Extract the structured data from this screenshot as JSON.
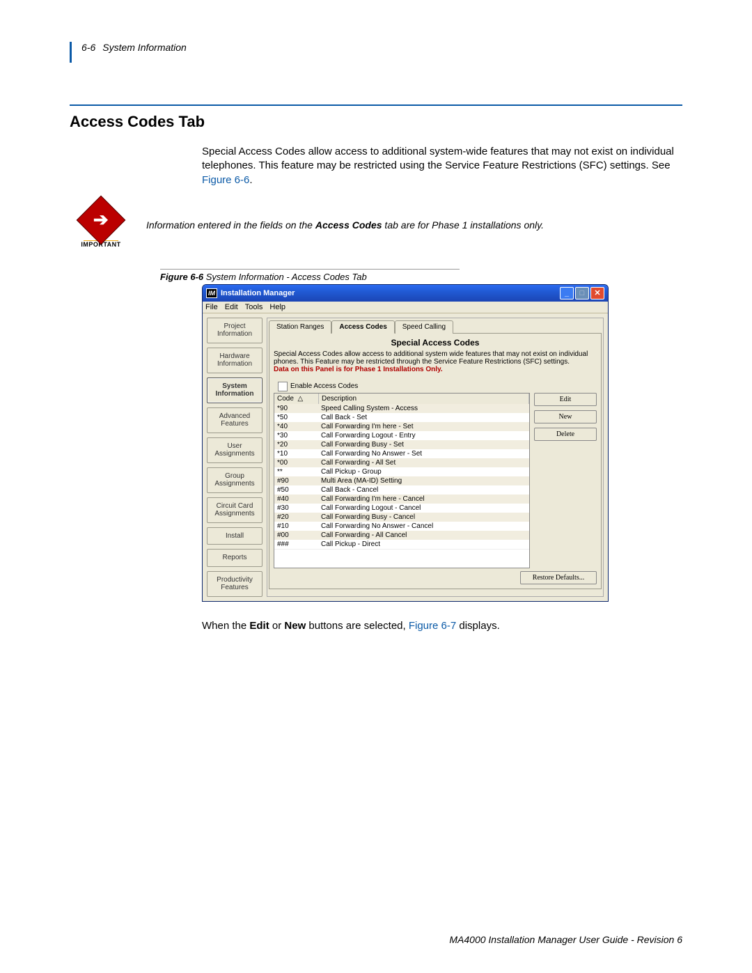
{
  "header": {
    "page_num": "6-6",
    "section": "System Information"
  },
  "title": "Access Codes Tab",
  "intro": {
    "text": "Special Access Codes allow access to additional system-wide features that may not exist on individual telephones. This feature may be restricted using the Service Feature Restrictions (SFC) settings. See ",
    "figref": "Figure 6-6",
    "period": "."
  },
  "important": {
    "label": "IMPORTANT",
    "note_pre": "Information entered in the fields on the ",
    "note_bold": "Access Codes",
    "note_post": " tab are for Phase 1 installations only."
  },
  "fig_caption_bold": "Figure 6-6",
  "fig_caption_rest": "  System Information - Access Codes Tab",
  "win": {
    "title": "Installation Manager",
    "menu": [
      "File",
      "Edit",
      "Tools",
      "Help"
    ],
    "nav": [
      "Project Information",
      "Hardware Information",
      "System Information",
      "Advanced Features",
      "User Assignments",
      "Group Assignments",
      "Circuit Card Assignments",
      "Install",
      "Reports",
      "Productivity Features"
    ],
    "active_nav_index": 2,
    "tabs": [
      "Station Ranges",
      "Access Codes",
      "Speed Calling"
    ],
    "active_tab_index": 1,
    "pane_title": "Special Access Codes",
    "pane_desc": "Special Access Codes allow access to additional system wide features that may not exist on individual phones.  This Feature may be restricted through the Service Feature Restrictions (SFC) settings.",
    "pane_red": "Data on this Panel is for Phase 1 Installations Only.",
    "enable_label": "Enable Access Codes",
    "cols": {
      "c1": "Code",
      "c2": "Description"
    },
    "rows": [
      {
        "code": "*90",
        "desc": "Speed Calling System - Access"
      },
      {
        "code": "*50",
        "desc": "Call Back - Set"
      },
      {
        "code": "*40",
        "desc": "Call Forwarding I'm here - Set"
      },
      {
        "code": "*30",
        "desc": "Call Forwarding Logout - Entry"
      },
      {
        "code": "*20",
        "desc": "Call Forwarding Busy - Set"
      },
      {
        "code": "*10",
        "desc": "Call Forwarding No Answer - Set"
      },
      {
        "code": "*00",
        "desc": "Call Forwarding - All Set"
      },
      {
        "code": "**",
        "desc": "Call Pickup - Group"
      },
      {
        "code": "#90",
        "desc": "Multi Area (MA-ID) Setting"
      },
      {
        "code": "#50",
        "desc": "Call Back - Cancel"
      },
      {
        "code": "#40",
        "desc": "Call Forwarding I'm here - Cancel"
      },
      {
        "code": "#30",
        "desc": "Call Forwarding Logout - Cancel"
      },
      {
        "code": "#20",
        "desc": "Call Forwarding Busy - Cancel"
      },
      {
        "code": "#10",
        "desc": "Call Forwarding No Answer - Cancel"
      },
      {
        "code": "#00",
        "desc": "Call Forwarding - All Cancel"
      },
      {
        "code": "###",
        "desc": "Call Pickup - Direct"
      }
    ],
    "actions": {
      "edit": "Edit",
      "new": "New",
      "delete": "Delete",
      "restore": "Restore Defaults..."
    }
  },
  "after": {
    "pre": "When the ",
    "b1": "Edit",
    "mid": " or ",
    "b2": "New",
    "post": " buttons are selected, ",
    "figref": "Figure 6-7",
    "end": " displays."
  },
  "footer": "MA4000 Installation Manager User Guide - Revision 6"
}
